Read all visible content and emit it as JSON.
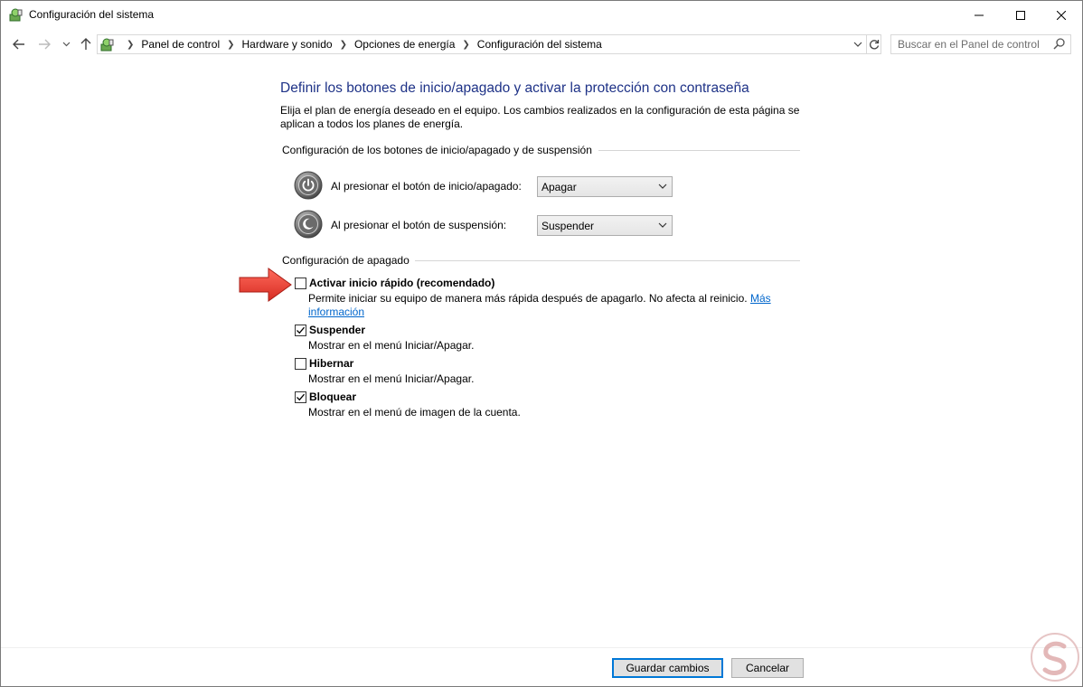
{
  "window": {
    "title": "Configuración del sistema",
    "minimize_label": "Minimizar",
    "maximize_label": "Maximizar",
    "close_label": "Cerrar"
  },
  "nav": {
    "breadcrumbs": [
      "Panel de control",
      "Hardware y sonido",
      "Opciones de energía",
      "Configuración del sistema"
    ],
    "search_placeholder": "Buscar en el Panel de control"
  },
  "content": {
    "heading": "Definir los botones de inicio/apagado y activar la protección con contraseña",
    "description": "Elija el plan de energía deseado en el equipo. Los cambios realizados en la configuración de esta página se aplican a todos los planes de energía.",
    "buttons_group_title": "Configuración de los botones de inicio/apagado y de suspensión",
    "power_button_label": "Al presionar el botón de inicio/apagado:",
    "power_button_value": "Apagar",
    "sleep_button_label": "Al presionar el botón de suspensión:",
    "sleep_button_value": "Suspender",
    "shutdown_group_title": "Configuración de apagado",
    "options": [
      {
        "label": "Activar inicio rápido (recomendado)",
        "checked": false,
        "description": "Permite iniciar su equipo de manera más rápida después de apagarlo. No afecta al reinicio.",
        "link_part1": "Más",
        "link_part2": "información"
      },
      {
        "label": "Suspender",
        "checked": true,
        "description": "Mostrar en el menú Iniciar/Apagar."
      },
      {
        "label": "Hibernar",
        "checked": false,
        "description": "Mostrar en el menú Iniciar/Apagar."
      },
      {
        "label": "Bloquear",
        "checked": true,
        "description": "Mostrar en el menú de imagen de la cuenta."
      }
    ]
  },
  "footer": {
    "save_label": "Guardar cambios",
    "cancel_label": "Cancelar"
  },
  "colors": {
    "heading": "#1e3287",
    "link": "#0066cc",
    "arrow": "#e8403a",
    "primary_border": "#0078d7"
  }
}
